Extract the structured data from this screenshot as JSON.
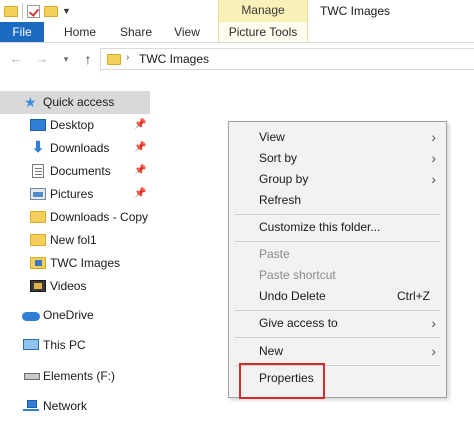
{
  "ribbon": {
    "contextual_group": "Manage",
    "window_title": "TWC Images",
    "tabs": {
      "file": "File",
      "home": "Home",
      "share": "Share",
      "view": "View",
      "picture_tools": "Picture Tools"
    }
  },
  "address_bar": {
    "path_segment": "TWC Images"
  },
  "nav_pane": {
    "items": [
      {
        "label": "Quick access",
        "icon": "star-icon"
      },
      {
        "label": "Desktop",
        "icon": "desktop-icon",
        "pin": "📌"
      },
      {
        "label": "Downloads",
        "icon": "download-icon",
        "pin": "📌"
      },
      {
        "label": "Documents",
        "icon": "documents-icon",
        "pin": "📌"
      },
      {
        "label": "Pictures",
        "icon": "pictures-icon",
        "pin": "📌"
      },
      {
        "label": "Downloads - Copy",
        "icon": "folder-icon"
      },
      {
        "label": "New fol1",
        "icon": "folder-icon"
      },
      {
        "label": "TWC Images",
        "icon": "image-folder-icon"
      },
      {
        "label": "Videos",
        "icon": "videos-icon"
      },
      {
        "label": "OneDrive",
        "icon": "cloud-icon"
      },
      {
        "label": "This PC",
        "icon": "pc-icon"
      },
      {
        "label": "Elements (F:)",
        "icon": "drive-icon"
      },
      {
        "label": "Network",
        "icon": "network-icon"
      }
    ]
  },
  "context_menu": {
    "view": "View",
    "sort_by": "Sort by",
    "group_by": "Group by",
    "refresh": "Refresh",
    "customize": "Customize this folder...",
    "paste": "Paste",
    "paste_shortcut": "Paste shortcut",
    "undo_delete": "Undo Delete",
    "undo_shortcut": "Ctrl+Z",
    "give_access": "Give access to",
    "new": "New",
    "properties": "Properties"
  },
  "colors": {
    "file_tab": "#1b6ac2",
    "manage_band": "#faf1b8",
    "highlight": "#d22b2b",
    "selected_nav": "#d9d9d9"
  }
}
